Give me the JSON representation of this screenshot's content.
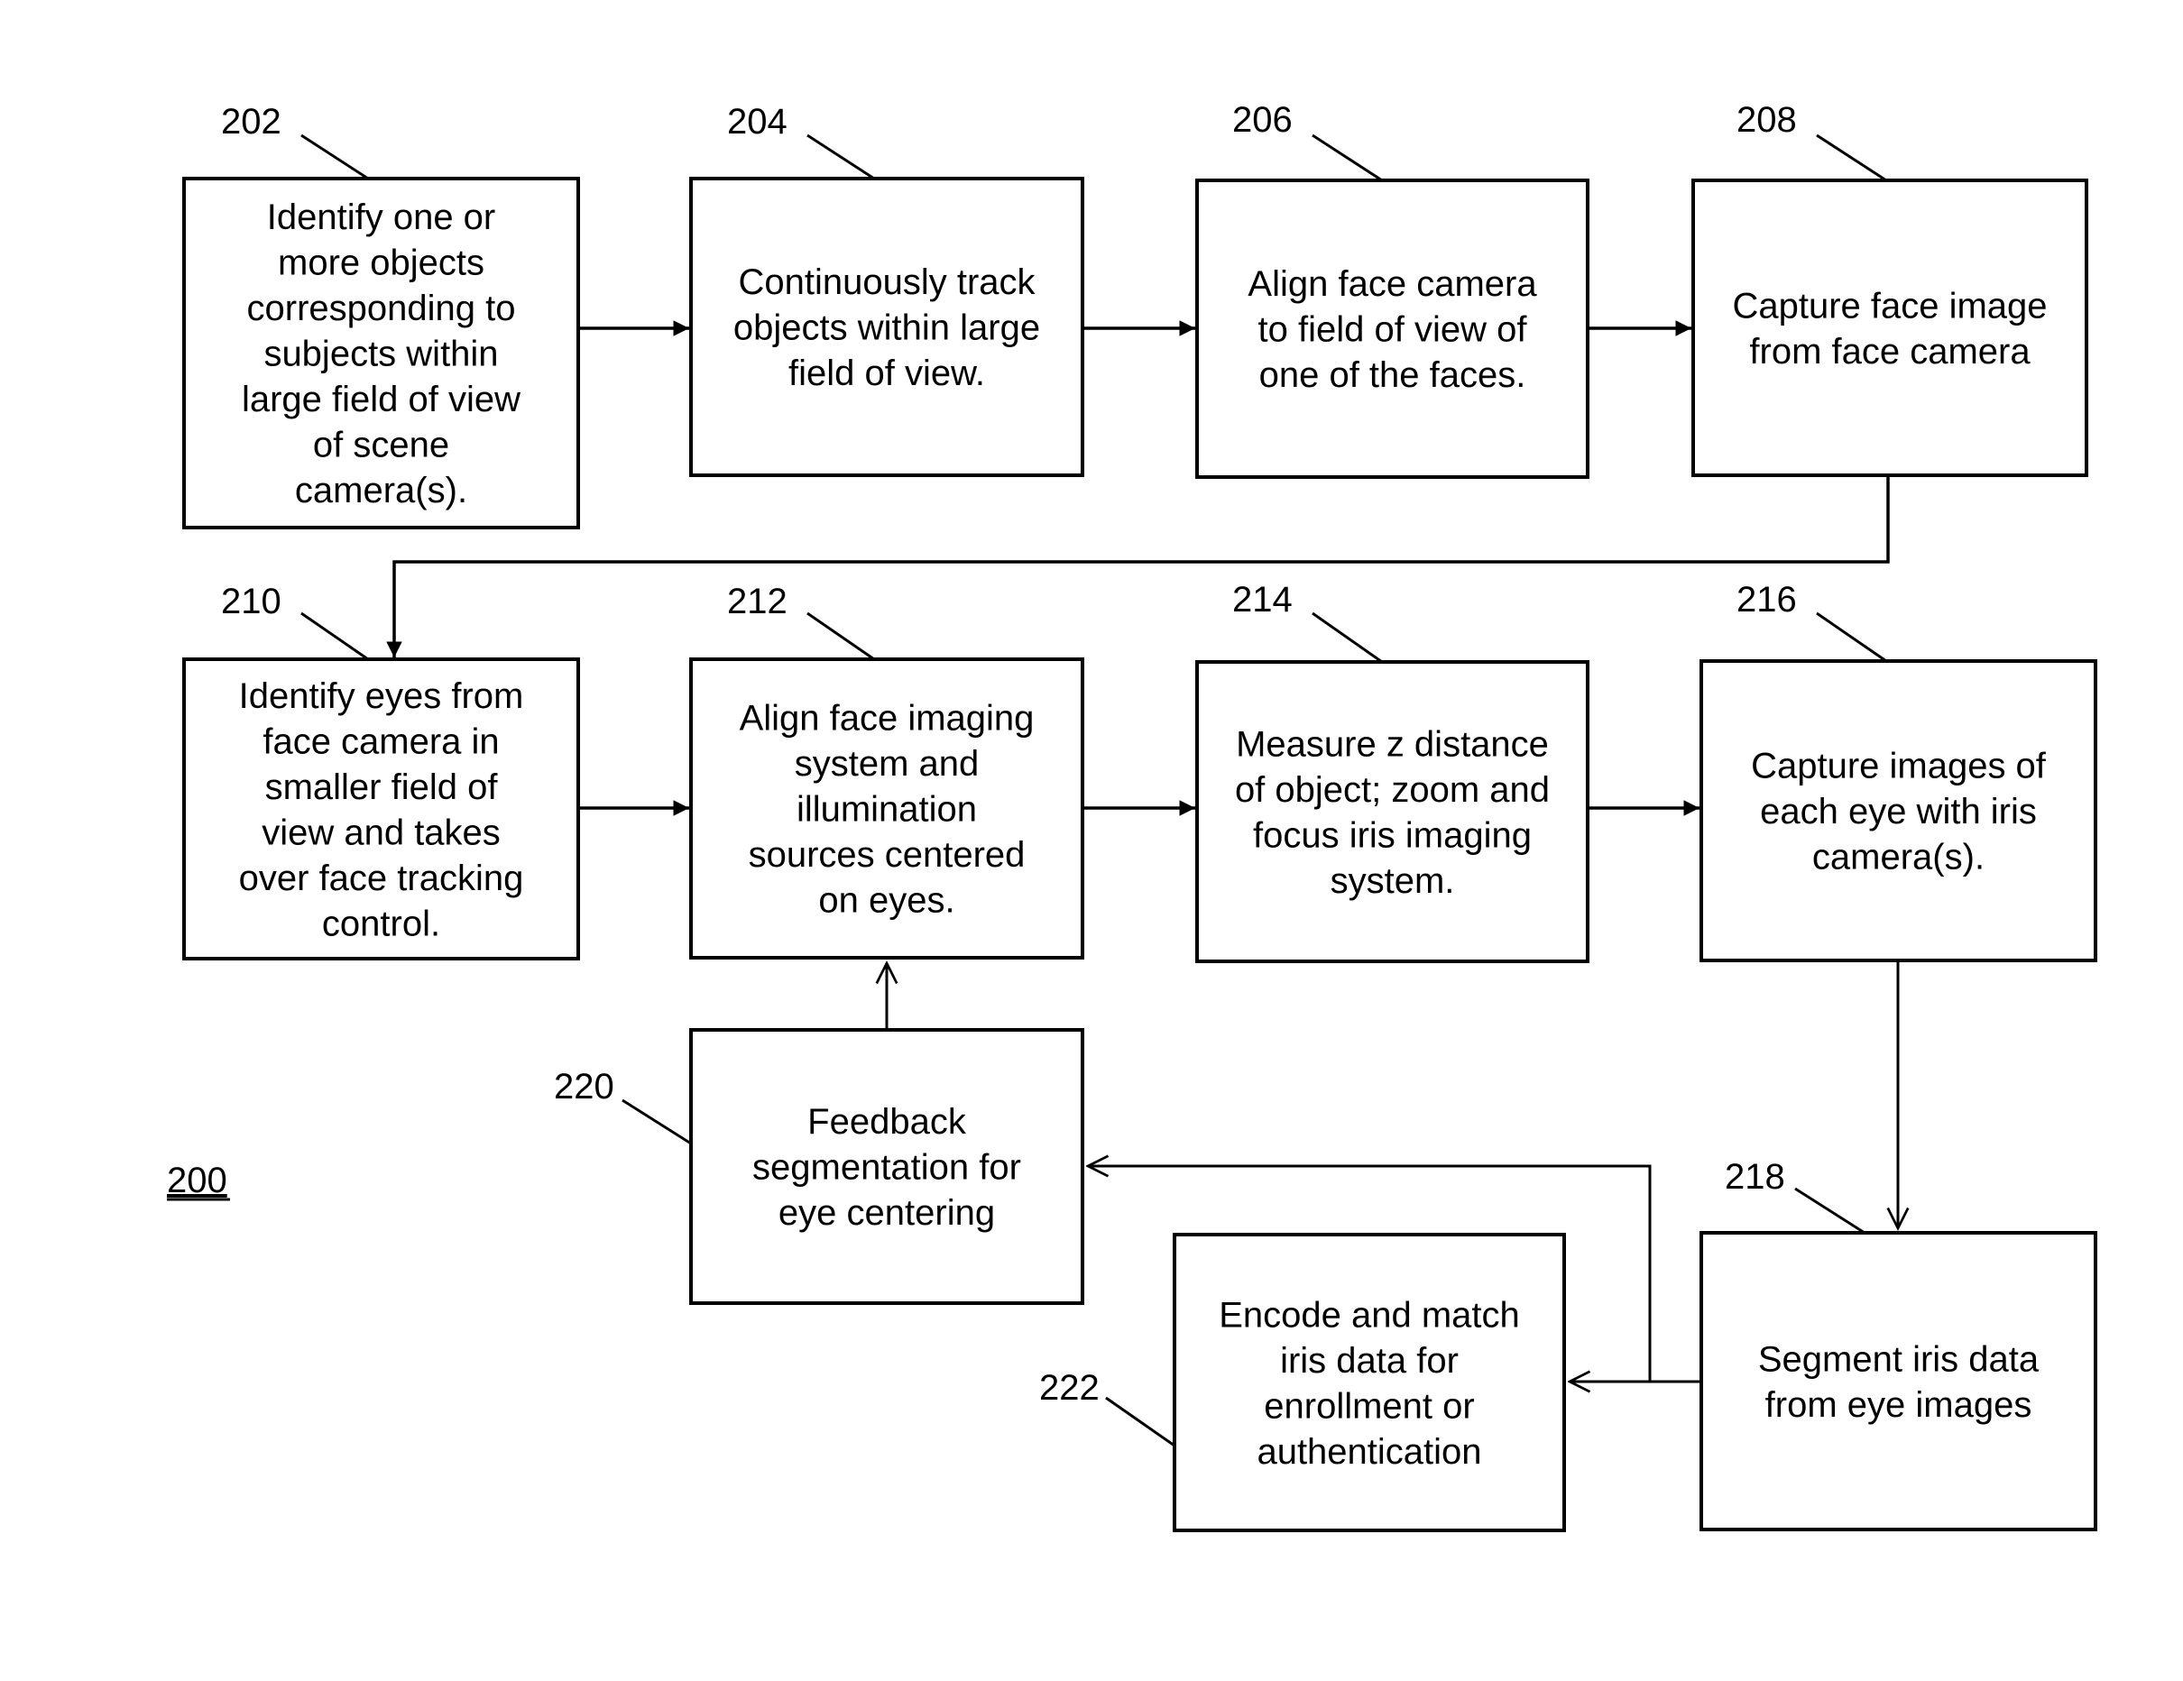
{
  "figure_label": "200",
  "steps": [
    {
      "id": "202",
      "lines": [
        "Identify one or",
        "more objects",
        "corresponding to",
        "subjects within",
        "large field of view",
        "of scene",
        "camera(s)."
      ]
    },
    {
      "id": "204",
      "lines": [
        "Continuously track",
        "objects within large",
        "field of view."
      ]
    },
    {
      "id": "206",
      "lines": [
        "Align face camera",
        "to field of view of",
        "one of the faces."
      ]
    },
    {
      "id": "208",
      "lines": [
        "Capture face image",
        "from face camera"
      ]
    },
    {
      "id": "210",
      "lines": [
        "Identify eyes from",
        "face camera in",
        "smaller field of",
        "view and takes",
        "over face tracking",
        "control."
      ]
    },
    {
      "id": "212",
      "lines": [
        "Align face imaging",
        "system and",
        "illumination",
        "sources centered",
        "on eyes."
      ]
    },
    {
      "id": "214",
      "lines": [
        "Measure z distance",
        "of object; zoom and",
        "focus iris imaging",
        "system."
      ]
    },
    {
      "id": "216",
      "lines": [
        "Capture images of",
        "each eye with iris",
        "camera(s)."
      ]
    },
    {
      "id": "218",
      "lines": [
        "Segment iris data",
        "from eye images"
      ]
    },
    {
      "id": "220",
      "lines": [
        "Feedback",
        "segmentation for",
        "eye centering"
      ]
    },
    {
      "id": "222",
      "lines": [
        "Encode and match",
        "iris data for",
        "enrollment or",
        "authentication"
      ]
    }
  ],
  "connections": [
    {
      "from": "202",
      "to": "204"
    },
    {
      "from": "204",
      "to": "206"
    },
    {
      "from": "206",
      "to": "208"
    },
    {
      "from": "208",
      "to": "210"
    },
    {
      "from": "210",
      "to": "212"
    },
    {
      "from": "212",
      "to": "214"
    },
    {
      "from": "214",
      "to": "216"
    },
    {
      "from": "216",
      "to": "218"
    },
    {
      "from": "218",
      "to": "220"
    },
    {
      "from": "218",
      "to": "222"
    },
    {
      "from": "220",
      "to": "212"
    }
  ]
}
